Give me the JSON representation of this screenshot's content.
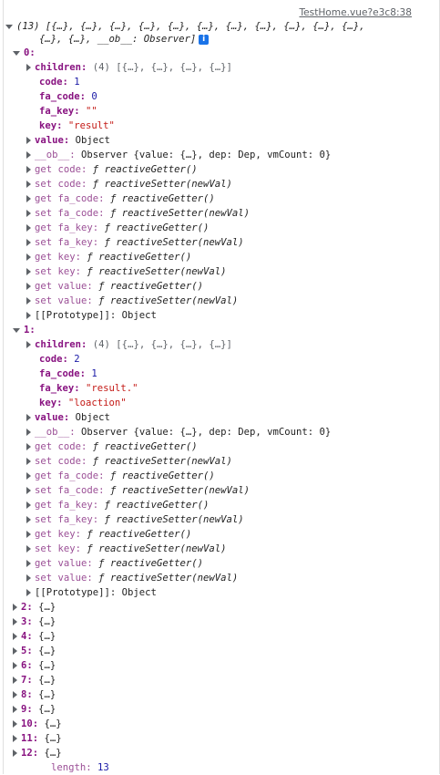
{
  "source_link": "TestHome.vue?e3c8:38",
  "array_summary_line1": "(13) [{…}, {…}, {…}, {…}, {…}, {…}, {…}, {…}, {…}, {…}, {…},",
  "array_summary_line2": "{…}, {…}, __ob__: Observer]",
  "info_icon": "i",
  "item0": {
    "index": "0:",
    "children_key": "children:",
    "children_val": "(4) [{…}, {…}, {…}, {…}]",
    "code_key": "code:",
    "code_val": "1",
    "fa_code_key": "fa_code:",
    "fa_code_val": "0",
    "fa_key_key": "fa_key:",
    "fa_key_val": "\"\"",
    "key_key": "key:",
    "key_val": "\"result\"",
    "value_key": "value:",
    "value_val": "Object",
    "ob_key": "__ob__:",
    "ob_val": "Observer {value: {…}, dep: Dep, vmCount: 0}",
    "accessors": [
      {
        "label": "get code:",
        "f": "ƒ",
        "fn": "reactiveGetter()"
      },
      {
        "label": "set code:",
        "f": "ƒ",
        "fn": "reactiveSetter(newVal)"
      },
      {
        "label": "get fa_code:",
        "f": "ƒ",
        "fn": "reactiveGetter()"
      },
      {
        "label": "set fa_code:",
        "f": "ƒ",
        "fn": "reactiveSetter(newVal)"
      },
      {
        "label": "get fa_key:",
        "f": "ƒ",
        "fn": "reactiveGetter()"
      },
      {
        "label": "set fa_key:",
        "f": "ƒ",
        "fn": "reactiveSetter(newVal)"
      },
      {
        "label": "get key:",
        "f": "ƒ",
        "fn": "reactiveGetter()"
      },
      {
        "label": "set key:",
        "f": "ƒ",
        "fn": "reactiveSetter(newVal)"
      },
      {
        "label": "get value:",
        "f": "ƒ",
        "fn": "reactiveGetter()"
      },
      {
        "label": "set value:",
        "f": "ƒ",
        "fn": "reactiveSetter(newVal)"
      }
    ],
    "proto": "[[Prototype]]: Object"
  },
  "item1": {
    "index": "1:",
    "children_key": "children:",
    "children_val": "(4) [{…}, {…}, {…}, {…}]",
    "code_key": "code:",
    "code_val": "2",
    "fa_code_key": "fa_code:",
    "fa_code_val": "1",
    "fa_key_key": "fa_key:",
    "fa_key_val": "\"result.\"",
    "key_key": "key:",
    "key_val": "\"loaction\"",
    "value_key": "value:",
    "value_val": "Object",
    "ob_key": "__ob__:",
    "ob_val": "Observer {value: {…}, dep: Dep, vmCount: 0}",
    "accessors": [
      {
        "label": "get code:",
        "f": "ƒ",
        "fn": "reactiveGetter()"
      },
      {
        "label": "set code:",
        "f": "ƒ",
        "fn": "reactiveSetter(newVal)"
      },
      {
        "label": "get fa_code:",
        "f": "ƒ",
        "fn": "reactiveGetter()"
      },
      {
        "label": "set fa_code:",
        "f": "ƒ",
        "fn": "reactiveSetter(newVal)"
      },
      {
        "label": "get fa_key:",
        "f": "ƒ",
        "fn": "reactiveGetter()"
      },
      {
        "label": "set fa_key:",
        "f": "ƒ",
        "fn": "reactiveSetter(newVal)"
      },
      {
        "label": "get key:",
        "f": "ƒ",
        "fn": "reactiveGetter()"
      },
      {
        "label": "set key:",
        "f": "ƒ",
        "fn": "reactiveSetter(newVal)"
      },
      {
        "label": "get value:",
        "f": "ƒ",
        "fn": "reactiveGetter()"
      },
      {
        "label": "set value:",
        "f": "ƒ",
        "fn": "reactiveSetter(newVal)"
      }
    ],
    "proto": "[[Prototype]]: Object"
  },
  "collapsed_items": [
    {
      "index": "2:",
      "val": "{…}"
    },
    {
      "index": "3:",
      "val": "{…}"
    },
    {
      "index": "4:",
      "val": "{…}"
    },
    {
      "index": "5:",
      "val": "{…}"
    },
    {
      "index": "6:",
      "val": "{…}"
    },
    {
      "index": "7:",
      "val": "{…}"
    },
    {
      "index": "8:",
      "val": "{…}"
    },
    {
      "index": "9:",
      "val": "{…}"
    },
    {
      "index": "10:",
      "val": "{…}"
    },
    {
      "index": "11:",
      "val": "{…}"
    },
    {
      "index": "12:",
      "val": "{…}"
    }
  ],
  "length_key": "length:",
  "length_val": "13",
  "colors": {
    "key": "#881280",
    "accessor": "#9b4f96",
    "number": "#1a1aa6",
    "string": "#c41a16",
    "info_icon": "#1a73e8"
  }
}
